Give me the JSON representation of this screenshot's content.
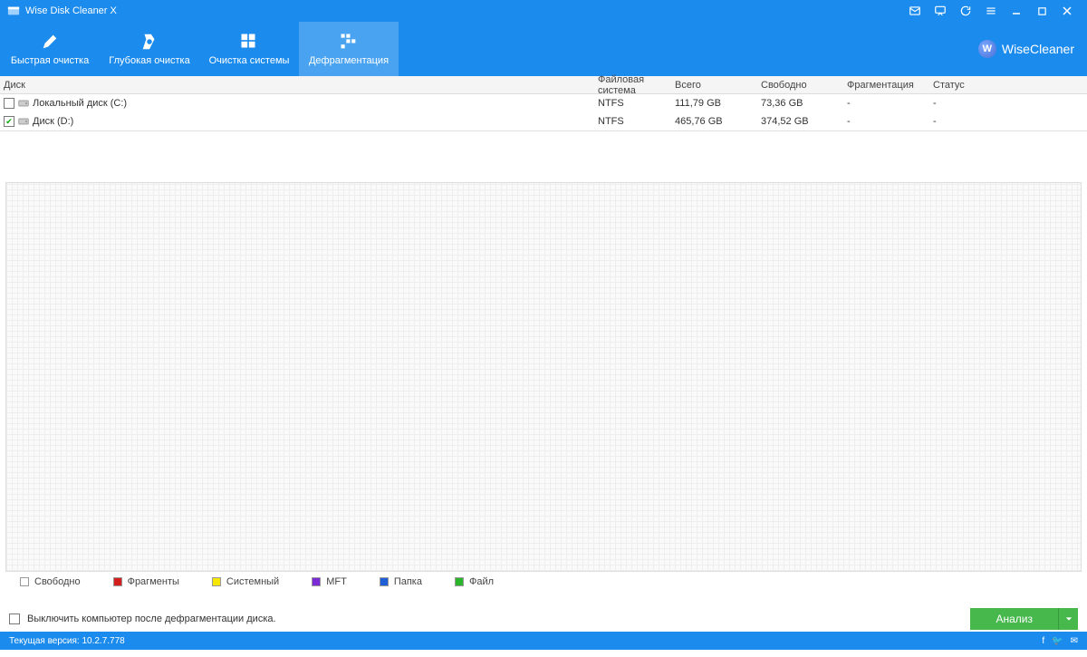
{
  "app": {
    "title": "Wise Disk Cleaner X",
    "brand": "WiseCleaner"
  },
  "tabs": {
    "quick": "Быстрая очистка",
    "deep": "Глубокая очистка",
    "system": "Очистка системы",
    "defrag": "Дефрагментация"
  },
  "table": {
    "headers": {
      "disk": "Диск",
      "fs": "Файловая система",
      "total": "Всего",
      "free": "Свободно",
      "frag": "Фрагментация",
      "status": "Статус"
    },
    "rows": [
      {
        "checked": false,
        "name": "Локальный диск (C:)",
        "fs": "NTFS",
        "total": "111,79 GB",
        "free": "73,36 GB",
        "frag": "-",
        "status": "-"
      },
      {
        "checked": true,
        "name": "Диск (D:)",
        "fs": "NTFS",
        "total": "465,76 GB",
        "free": "374,52 GB",
        "frag": "-",
        "status": "-"
      }
    ]
  },
  "legend": {
    "free": "Свободно",
    "fragments": "Фрагменты",
    "system": "Системный",
    "mft": "MFT",
    "folder": "Папка",
    "file": "Файл"
  },
  "legend_colors": {
    "free": "#ffffff",
    "fragments": "#d21f1f",
    "system": "#f7e600",
    "mft": "#7a2bd4",
    "folder": "#1e5fd6",
    "file": "#2bb52b"
  },
  "shutdown_label": "Выключить компьютер после дефрагментации диска.",
  "analyze_label": "Анализ",
  "version_label": "Текущая версия: 10.2.7.778"
}
